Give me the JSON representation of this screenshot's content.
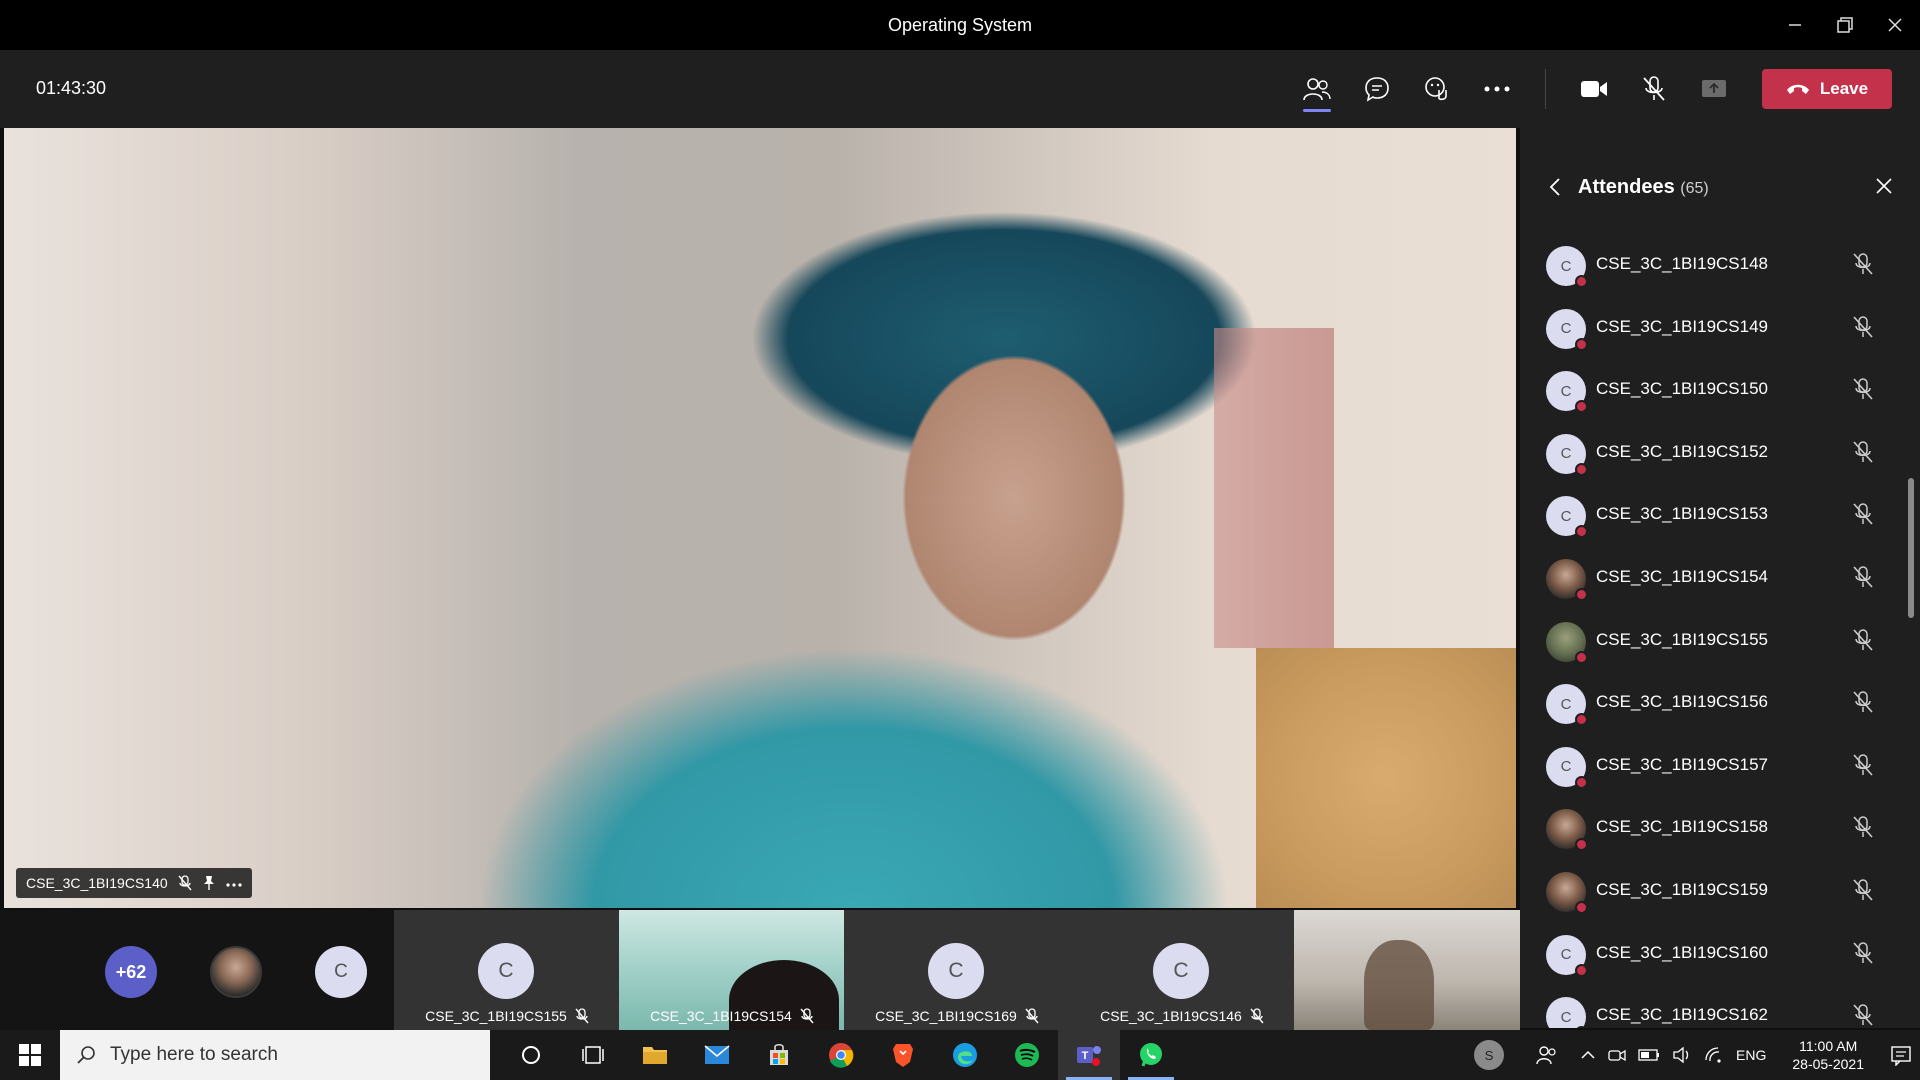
{
  "window": {
    "title": "Operating System"
  },
  "meeting": {
    "timer": "01:43:30",
    "leave_label": "Leave"
  },
  "stage": {
    "speaker_name": "CSE_3C_1BI19CS140"
  },
  "strip": {
    "overflow_label": "+62",
    "letter_chip": "C",
    "tiles": [
      {
        "initial": "C",
        "name": "CSE_3C_1BI19CS155"
      },
      {
        "name": "CSE_3C_1BI19CS154"
      },
      {
        "initial": "C",
        "name": "CSE_3C_1BI19CS169"
      },
      {
        "initial": "C",
        "name": "CSE_3C_1BI19CS146"
      }
    ]
  },
  "attendees": {
    "title": "Attendees",
    "count": "(65)",
    "items": [
      {
        "initial": "C",
        "name": "CSE_3C_1BI19CS148"
      },
      {
        "initial": "C",
        "name": "CSE_3C_1BI19CS149"
      },
      {
        "initial": "C",
        "name": "CSE_3C_1BI19CS150"
      },
      {
        "initial": "C",
        "name": "CSE_3C_1BI19CS152"
      },
      {
        "initial": "C",
        "name": "CSE_3C_1BI19CS153"
      },
      {
        "initial": "",
        "name": "CSE_3C_1BI19CS154",
        "photo": true
      },
      {
        "initial": "",
        "name": "CSE_3C_1BI19CS155",
        "photo": true
      },
      {
        "initial": "C",
        "name": "CSE_3C_1BI19CS156"
      },
      {
        "initial": "C",
        "name": "CSE_3C_1BI19CS157"
      },
      {
        "initial": "",
        "name": "CSE_3C_1BI19CS158",
        "photo": true
      },
      {
        "initial": "",
        "name": "CSE_3C_1BI19CS159",
        "photo": true
      },
      {
        "initial": "C",
        "name": "CSE_3C_1BI19CS160"
      },
      {
        "initial": "C",
        "name": "CSE_3C_1BI19CS162"
      }
    ]
  },
  "taskbar": {
    "search_placeholder": "Type here to search",
    "tray_user": "S",
    "language": "ENG",
    "time": "11:00 AM",
    "date": "28-05-2021"
  },
  "colors": {
    "accent": "#7f85f5",
    "leave": "#c4314b",
    "overflow_chip": "#5b5fc7"
  }
}
